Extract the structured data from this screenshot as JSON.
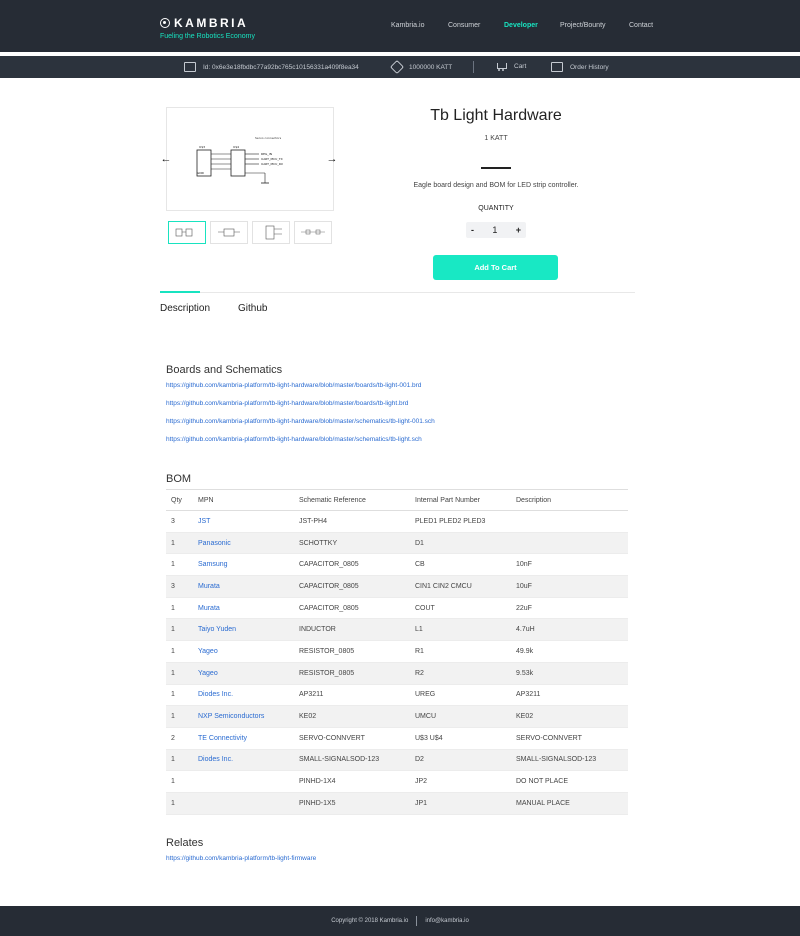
{
  "header": {
    "logo_text": "KAMBRIA",
    "tagline": "Fueling the Robotics Economy",
    "nav": [
      "Kambria.io",
      "Consumer",
      "Developer",
      "Project/Bounty",
      "Contact"
    ]
  },
  "subbar": {
    "wallet_id": "Id: 0x6e3e18fbdbc77a92bc765c10156331a409f8ea34",
    "balance": "1000000 KATT",
    "cart": "Cart",
    "order_history": "Order History"
  },
  "product": {
    "title": "Tb Light Hardware",
    "price": "1 KATT",
    "description": "Eagle board design and BOM for LED strip controller.",
    "quantity_label": "QUANTITY",
    "quantity": "1",
    "minus": "-",
    "plus": "+",
    "add_to_cart": "Add To Cart",
    "schematic_labels": [
      "Servo connectors",
      "REG_IN",
      "UART_MCU_TX",
      "UART_MCU_RX",
      "U$3",
      "U$4",
      "GND"
    ]
  },
  "tabs": [
    "Description",
    "Github"
  ],
  "boards": {
    "heading": "Boards and Schematics",
    "links": [
      "https://github.com/kambria-platform/tb-light-hardware/blob/master/boards/tb-light-001.brd",
      "https://github.com/kambria-platform/tb-light-hardware/blob/master/boards/tb-light.brd",
      "https://github.com/kambria-platform/tb-light-hardware/blob/master/schematics/tb-light-001.sch",
      "https://github.com/kambria-platform/tb-light-hardware/blob/master/schematics/tb-light.sch"
    ]
  },
  "bom": {
    "heading": "BOM",
    "columns": [
      "Qty",
      "MPN",
      "Schematic Reference",
      "Internal Part Number",
      "Description"
    ],
    "rows": [
      [
        "3",
        "JST",
        "JST-PH4",
        "PLED1 PLED2 PLED3",
        ""
      ],
      [
        "1",
        "Panasonic",
        "SCHOTTKY",
        "D1",
        ""
      ],
      [
        "1",
        "Samsung",
        "CAPACITOR_0805",
        "CB",
        "10nF"
      ],
      [
        "3",
        "Murata",
        "CAPACITOR_0805",
        "CIN1 CIN2 CMCU",
        "10uF"
      ],
      [
        "1",
        "Murata",
        "CAPACITOR_0805",
        "COUT",
        "22uF"
      ],
      [
        "1",
        "Taiyo Yuden",
        "INDUCTOR",
        "L1",
        "4.7uH"
      ],
      [
        "1",
        "Yageo",
        "RESISTOR_0805",
        "R1",
        "49.9k"
      ],
      [
        "1",
        "Yageo",
        "RESISTOR_0805",
        "R2",
        "9.53k"
      ],
      [
        "1",
        "Diodes Inc.",
        "AP3211",
        "UREG",
        "AP3211"
      ],
      [
        "1",
        "NXP Semiconductors",
        "KE02",
        "UMCU",
        "KE02"
      ],
      [
        "2",
        "TE Connectivity",
        "SERVO-CONNVERT",
        "U$3 U$4",
        "SERVO-CONNVERT"
      ],
      [
        "1",
        "Diodes Inc.",
        "SMALL-SIGNALSOD-123",
        "D2",
        "SMALL-SIGNALSOD-123"
      ],
      [
        "1",
        "",
        "PINHD-1X4",
        "JP2",
        "DO NOT PLACE"
      ],
      [
        "1",
        "",
        "PINHD-1X5",
        "JP1",
        "MANUAL PLACE"
      ]
    ]
  },
  "relates": {
    "heading": "Relates",
    "link": "https://github.com/kambria-platform/tb-light-firmware"
  },
  "footer": {
    "copyright": "Copyright © 2018 Kambria.io",
    "email": "info@kambria.io"
  },
  "colors": {
    "accent": "#18e3c0",
    "header_bg": "#262c35",
    "link": "#2a6bd1"
  }
}
